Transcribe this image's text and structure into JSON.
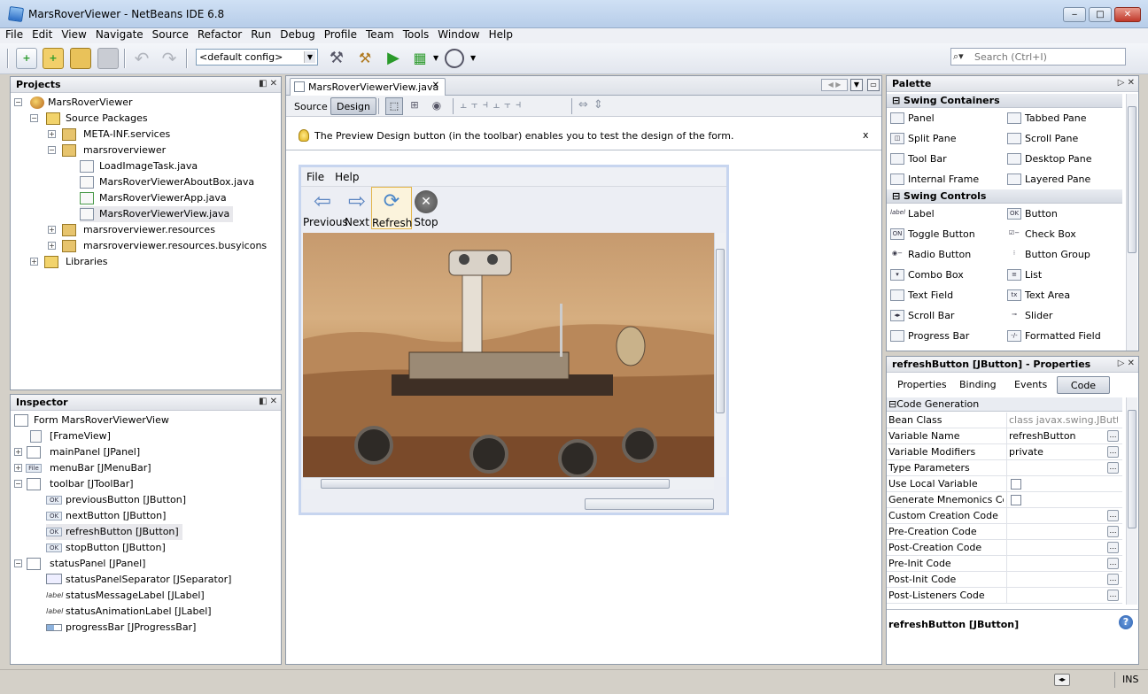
{
  "window": {
    "title": "MarsRoverViewer - NetBeans IDE 6.8"
  },
  "menubar": [
    "File",
    "Edit",
    "View",
    "Navigate",
    "Source",
    "Refactor",
    "Run",
    "Debug",
    "Profile",
    "Team",
    "Tools",
    "Window",
    "Help"
  ],
  "toolbar": {
    "config": "<default config>",
    "search_placeholder": "Search (Ctrl+I)"
  },
  "projects": {
    "header": "Projects",
    "items": [
      "MarsRoverViewer",
      "Source Packages",
      "META-INF.services",
      "marsroverviewer",
      "LoadImageTask.java",
      "MarsRoverViewerAboutBox.java",
      "MarsRoverViewerApp.java",
      "MarsRoverViewerView.java",
      "marsroverviewer.resources",
      "marsroverviewer.resources.busyicons",
      "Libraries"
    ]
  },
  "inspector": {
    "header": "Inspector",
    "items": [
      "Form MarsRoverViewerView",
      "[FrameView]",
      "mainPanel [JPanel]",
      "menuBar [JMenuBar]",
      "toolbar [JToolBar]",
      "previousButton [JButton]",
      "nextButton [JButton]",
      "refreshButton [JButton]",
      "stopButton [JButton]",
      "statusPanel [JPanel]",
      "statusPanelSeparator [JSeparator]",
      "statusMessageLabel [JLabel]",
      "statusAnimationLabel [JLabel]",
      "progressBar [JProgressBar]"
    ]
  },
  "editor": {
    "tab": "MarsRoverViewerView.java",
    "source_btn": "Source",
    "design_btn": "Design",
    "hint": "The Preview Design button (in the toolbar) enables you to test the design of the form.",
    "hint_close": "x",
    "form_menu": [
      "File",
      "Help"
    ],
    "form_buttons": [
      "Previous",
      "Next",
      "Refresh",
      "Stop"
    ]
  },
  "palette": {
    "header": "Palette",
    "group1": "Swing Containers",
    "containers": [
      "Panel",
      "Tabbed Pane",
      "Split Pane",
      "Scroll Pane",
      "Tool Bar",
      "Desktop Pane",
      "Internal Frame",
      "Layered Pane"
    ],
    "group2": "Swing Controls",
    "controls": [
      "Label",
      "Button",
      "Toggle Button",
      "Check Box",
      "Radio Button",
      "Button Group",
      "Combo Box",
      "List",
      "Text Field",
      "Text Area",
      "Scroll Bar",
      "Slider",
      "Progress Bar",
      "Formatted Field"
    ]
  },
  "properties": {
    "header": "refreshButton [JButton] - Properties",
    "tabs": [
      "Properties",
      "Binding",
      "Events",
      "Code"
    ],
    "section": "Code Generation",
    "rows": [
      {
        "k": "Bean Class",
        "v": "class javax.swing.JButton"
      },
      {
        "k": "Variable Name",
        "v": "refreshButton"
      },
      {
        "k": "Variable Modifiers",
        "v": "private"
      },
      {
        "k": "Type Parameters",
        "v": ""
      },
      {
        "k": "Use Local Variable",
        "v": ""
      },
      {
        "k": "Generate Mnemonics Code",
        "v": ""
      },
      {
        "k": "Custom Creation Code",
        "v": ""
      },
      {
        "k": "Pre-Creation Code",
        "v": ""
      },
      {
        "k": "Post-Creation Code",
        "v": ""
      },
      {
        "k": "Pre-Init Code",
        "v": ""
      },
      {
        "k": "Post-Init Code",
        "v": ""
      },
      {
        "k": "Post-Listeners Code",
        "v": ""
      }
    ],
    "footer": "refreshButton [JButton]"
  },
  "statusbar": {
    "mode": "INS"
  }
}
